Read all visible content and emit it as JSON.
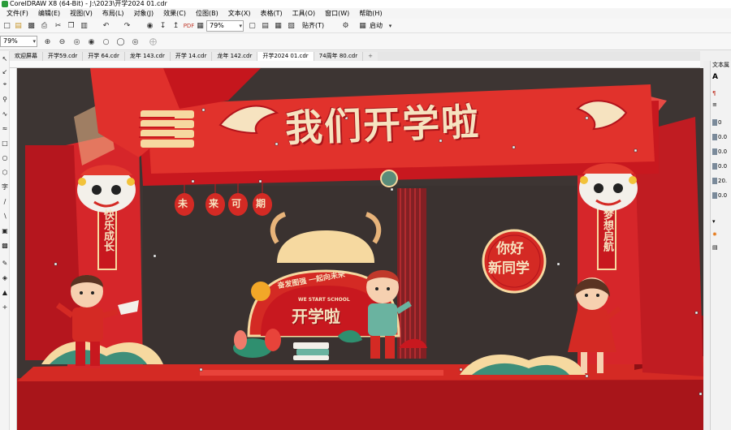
{
  "window": {
    "title": "CorelDRAW X8 (64-Bit) - J:\\2023\\开学2024 01.cdr"
  },
  "menu": [
    "文件(F)",
    "编辑(E)",
    "视图(V)",
    "布局(L)",
    "对象(J)",
    "效果(C)",
    "位图(B)",
    "文本(X)",
    "表格(T)",
    "工具(O)",
    "窗口(W)",
    "帮助(H)"
  ],
  "toolbar": {
    "zoom_value": "79%",
    "snap_label": "贴齐(T)",
    "launch_label": "启动",
    "zoom_left_value": "79%"
  },
  "tabs": [
    {
      "label": "欢迎屏幕",
      "active": false
    },
    {
      "label": "开学59.cdr",
      "active": false
    },
    {
      "label": "开学 64.cdr",
      "active": false
    },
    {
      "label": "龙年 143.cdr",
      "active": false
    },
    {
      "label": "开学 14.cdr",
      "active": false
    },
    {
      "label": "龙年 142.cdr",
      "active": false
    },
    {
      "label": "开学2024 01.cdr",
      "active": true
    },
    {
      "label": "74周年 80.cdr",
      "active": false
    },
    {
      "label": "+",
      "active": false
    }
  ],
  "right_panel": {
    "title": "文本属",
    "values": [
      "0",
      "0.0",
      "0.0",
      "0.0",
      "20.",
      "0.0"
    ]
  },
  "artwork": {
    "headline": "我们开学啦",
    "lanterns": [
      "未",
      "来",
      "可",
      "期"
    ],
    "left_banner": "快乐成长",
    "right_banner": "梦想启航",
    "circle_line1": "你好",
    "circle_line2": "新同学",
    "arc_text": "奋发图强 一起向未来",
    "school_text": "WE START SCHOOL",
    "center_title": "开学啦"
  },
  "colors": {
    "canvas_bg": "#3d3533",
    "stage_red": "#d42a24",
    "dark_red": "#a8151a",
    "gold": "#f6d9a0"
  }
}
